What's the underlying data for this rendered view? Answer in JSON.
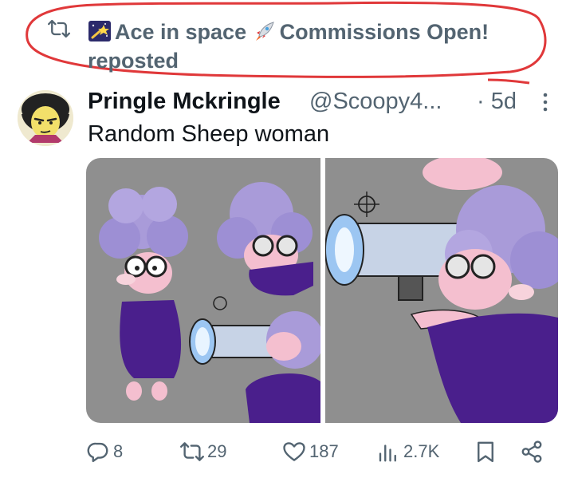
{
  "repost": {
    "line1": "Ace in space",
    "line1b": "Commissions Open!",
    "line2": "reposted"
  },
  "tweet": {
    "display_name": "Pringle Mckringle",
    "handle": "@Scoopy4...",
    "time": "· 5d",
    "text": "Random Sheep woman"
  },
  "actions": {
    "replies": "8",
    "reposts": "29",
    "likes": "187",
    "views": "2.7K"
  },
  "colors": {
    "muted": "#536471",
    "text": "#0f1419",
    "annotation": "#e0383a",
    "media_bg": "#8f8f8f"
  },
  "icons": [
    "repost-icon",
    "more-icon",
    "reply-icon",
    "like-icon",
    "views-icon",
    "bookmark-icon",
    "share-icon"
  ]
}
